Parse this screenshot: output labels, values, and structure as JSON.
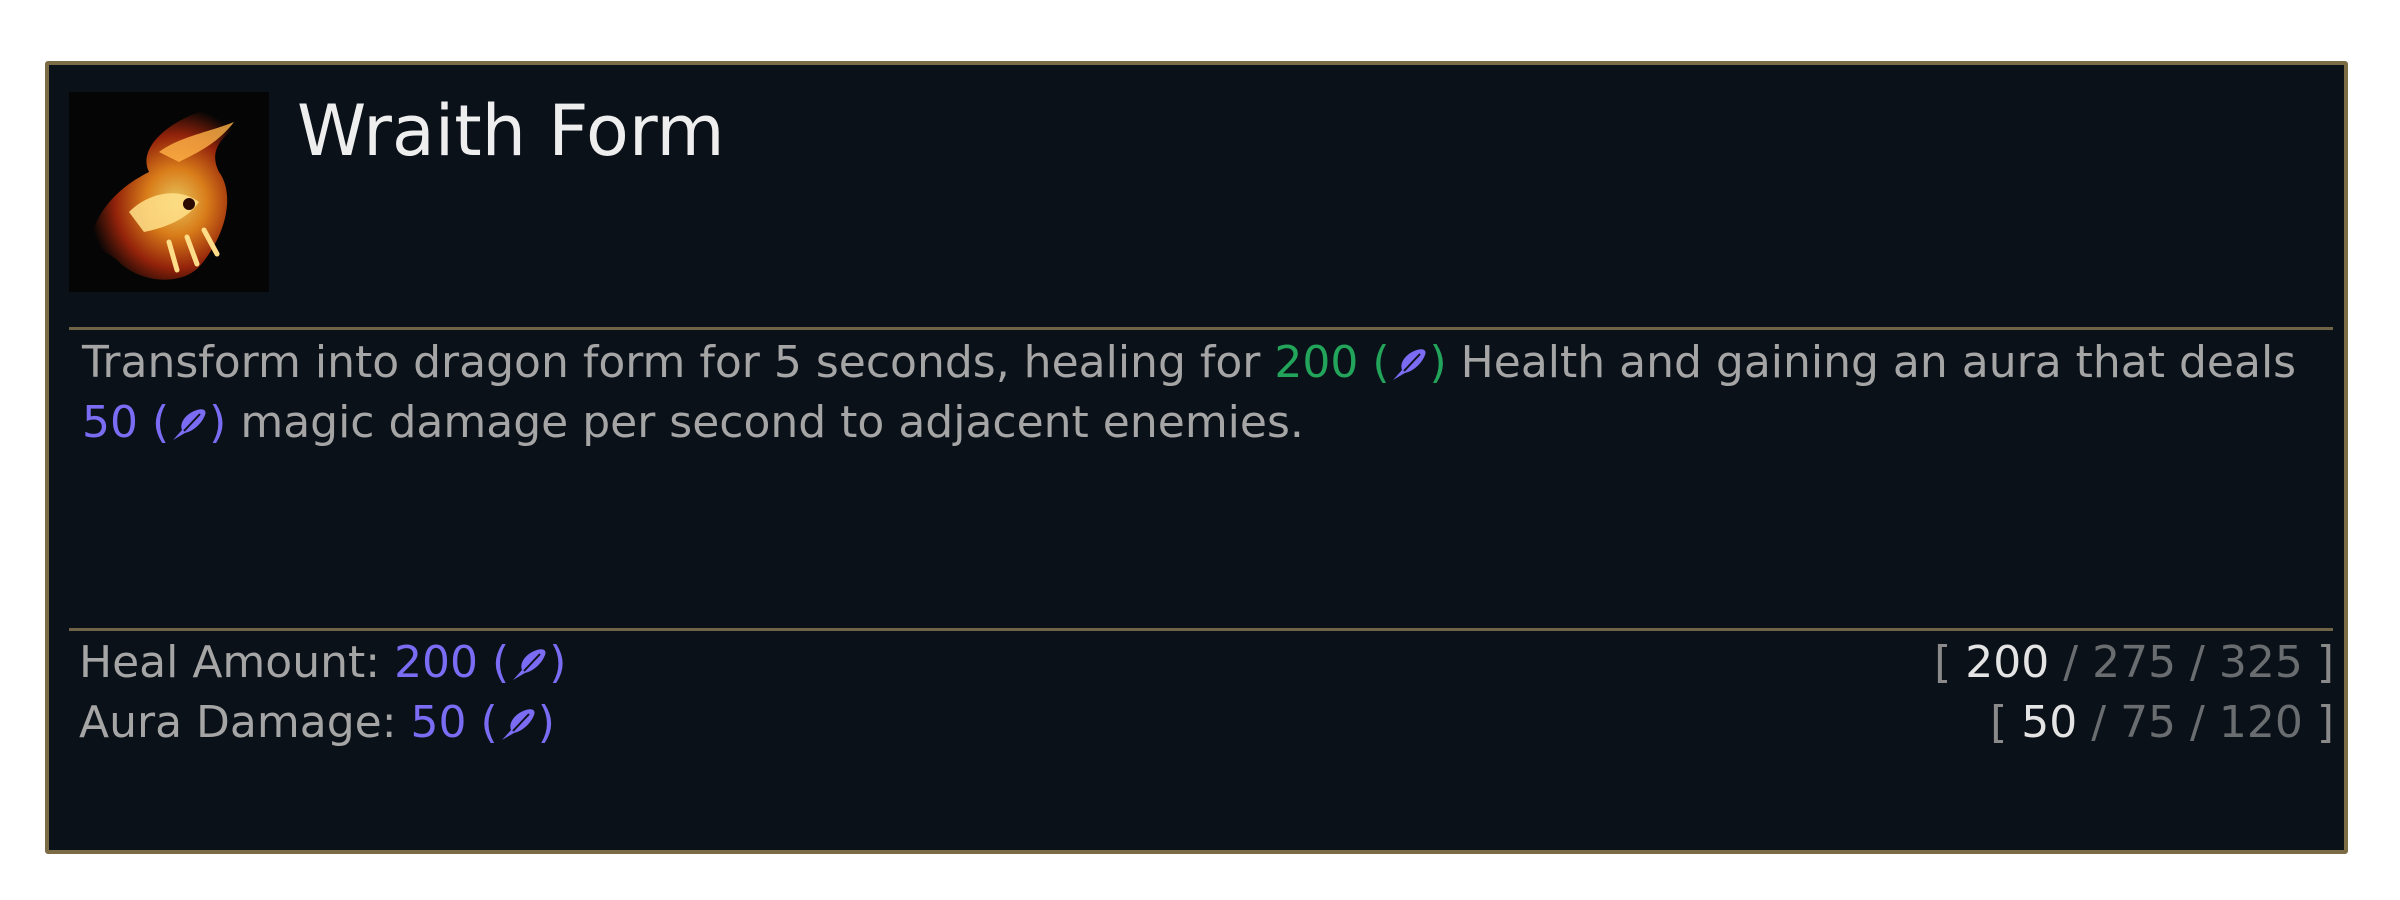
{
  "ability": {
    "name": "Wraith Form",
    "icon": "fire-dragon-icon",
    "description": {
      "part1": "Transform into dragon form for 5 seconds, healing for ",
      "heal_value": "200",
      "part2": "Health and gaining an aura that deals ",
      "damage_value": "50",
      "part3": "magic damage per second to adjacent enemies."
    }
  },
  "stats": [
    {
      "label": "Heal Amount:",
      "value": "200",
      "ranks": [
        "200",
        "275",
        "325"
      ]
    },
    {
      "label": "Aura Damage:",
      "value": "50",
      "ranks": [
        "50",
        "75",
        "120"
      ]
    }
  ],
  "colors": {
    "frame": "#7c6c46",
    "background": "#0b1119",
    "heal": "#22a55a",
    "ability_power": "#7b6cf3",
    "text": "#a5a5a5"
  }
}
